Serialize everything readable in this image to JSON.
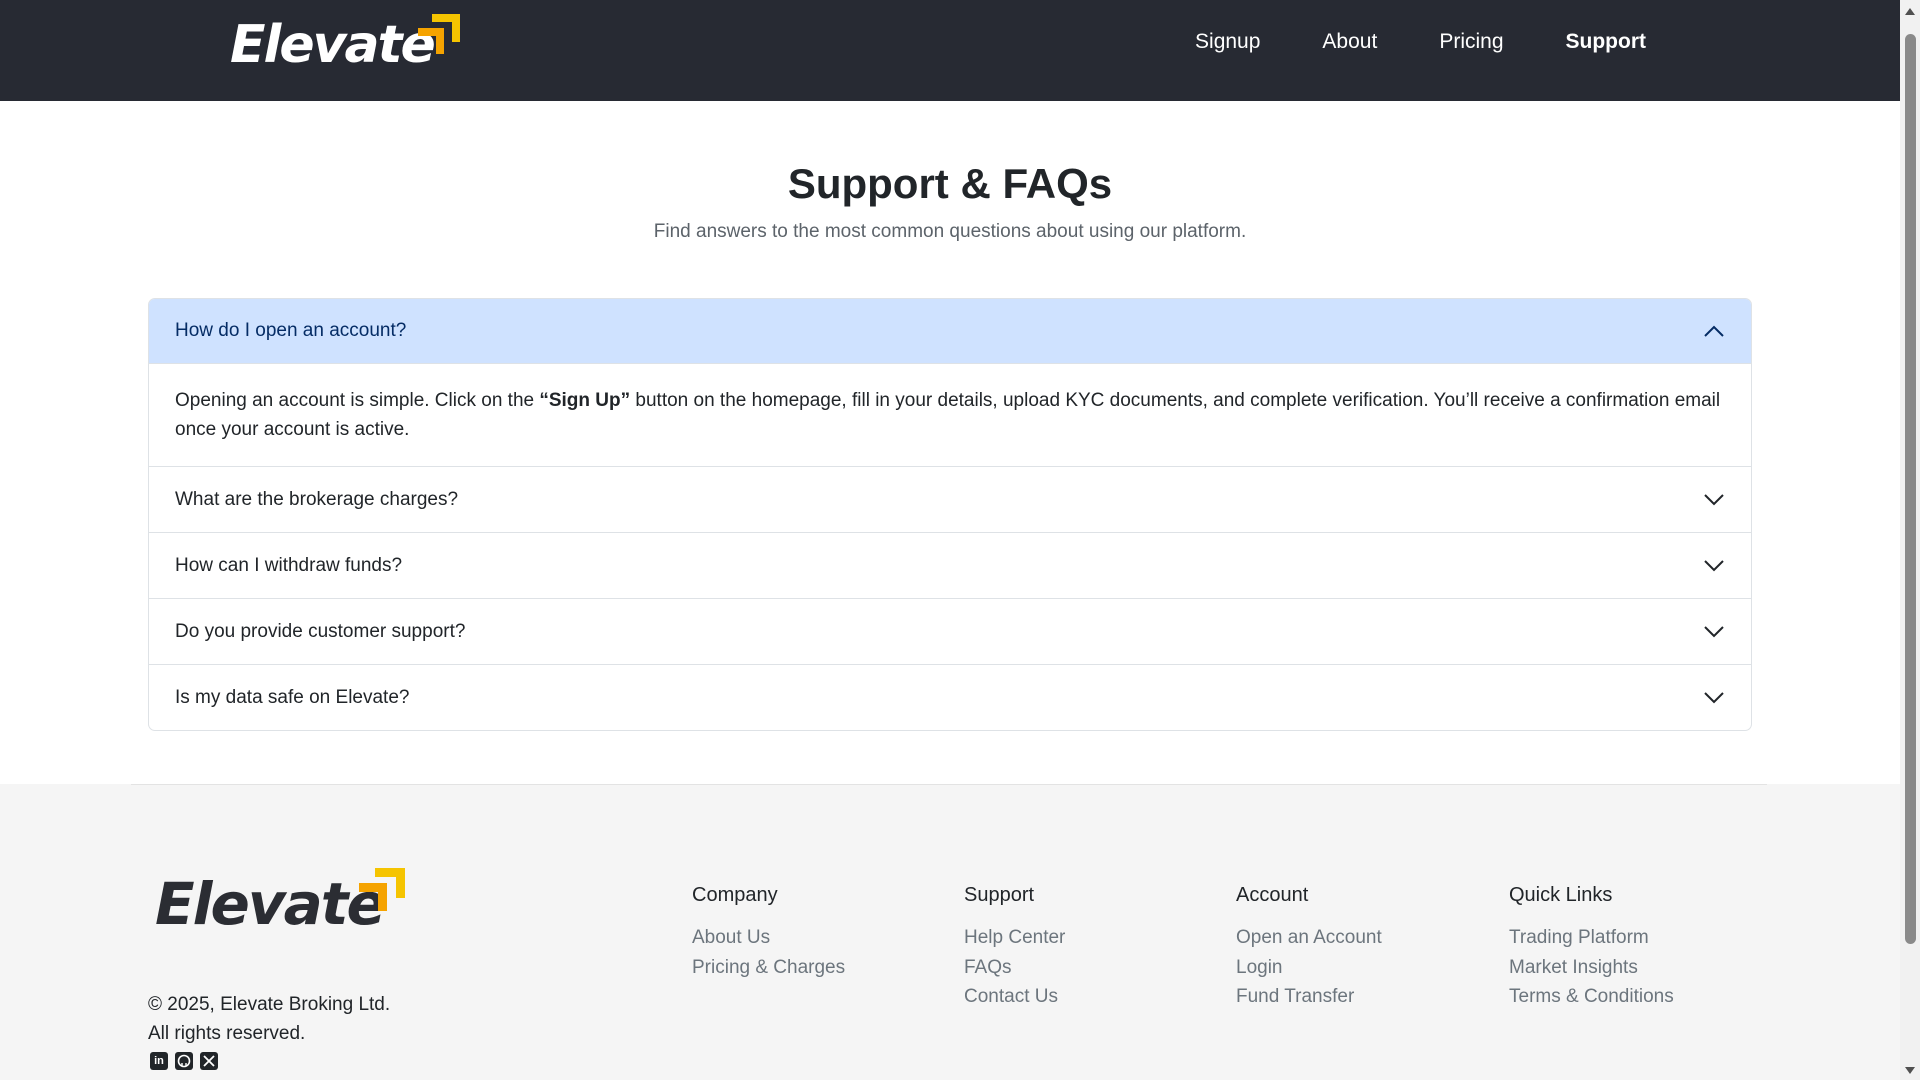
{
  "brand": {
    "name": "Elevate",
    "accent": "#f5c400"
  },
  "nav": {
    "links": [
      {
        "label": "Signup"
      },
      {
        "label": "About"
      },
      {
        "label": "Pricing"
      },
      {
        "label": "Support",
        "active": true
      }
    ]
  },
  "header": {
    "title": "Support & FAQs",
    "subtitle": "Find answers to the most common questions about using our platform."
  },
  "faqs": [
    {
      "question": "How do I open an account?",
      "expanded": true,
      "answer_pre": "Opening an account is simple. Click on the ",
      "answer_bold": "“Sign Up”",
      "answer_post": " button on the homepage, fill in your details, upload KYC documents, and complete verification. You’ll receive a confirmation email once your account is active."
    },
    {
      "question": "What are the brokerage charges?",
      "expanded": false
    },
    {
      "question": "How can I withdraw funds?",
      "expanded": false
    },
    {
      "question": "Do you provide customer support?",
      "expanded": false
    },
    {
      "question": "Is my data safe on Elevate?",
      "expanded": false
    }
  ],
  "footer": {
    "copyright_line1": "© 2025, Elevate Broking Ltd.",
    "copyright_line2": "All rights reserved.",
    "socials": [
      "linkedin-icon",
      "github-icon",
      "x-icon"
    ],
    "columns": [
      {
        "title": "Company",
        "links": [
          "About Us",
          "Pricing & Charges"
        ]
      },
      {
        "title": "Support",
        "links": [
          "Help Center",
          "FAQs",
          "Contact Us"
        ]
      },
      {
        "title": "Account",
        "links": [
          "Open an Account",
          "Login",
          "Fund Transfer"
        ]
      },
      {
        "title": "Quick Links",
        "links": [
          "Trading Platform",
          "Market Insights",
          "Terms & Conditions"
        ]
      }
    ]
  },
  "colors": {
    "navbar_bg": "#272a33",
    "accordion_open_bg": "#cfe2ff",
    "footer_bg": "#f5f5f5"
  }
}
